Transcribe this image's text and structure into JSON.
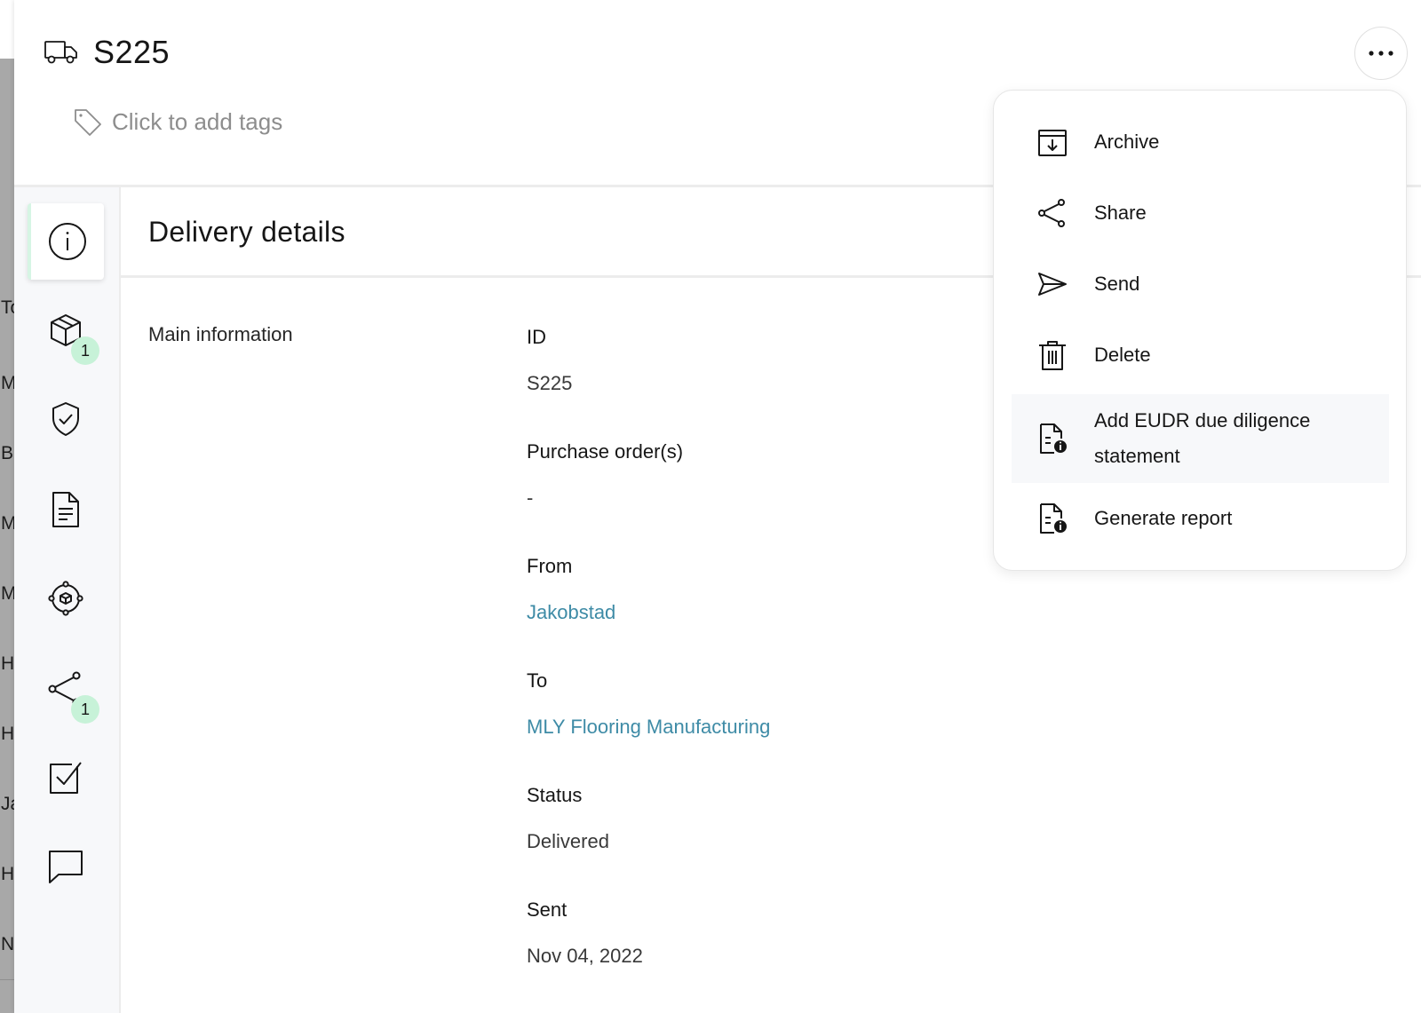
{
  "background_list": {
    "rows": [
      "To",
      "M",
      "B",
      "M",
      "M",
      "H",
      "H",
      "Ja",
      "H",
      "N"
    ]
  },
  "header": {
    "title": "S225",
    "tags_placeholder": "Click to add tags"
  },
  "rail": {
    "items": [
      {
        "icon": "info-icon",
        "active": true
      },
      {
        "icon": "package-icon",
        "badge": "1"
      },
      {
        "icon": "shield-check-icon"
      },
      {
        "icon": "document-icon"
      },
      {
        "icon": "network-icon"
      },
      {
        "icon": "share-icon",
        "badge": "1"
      },
      {
        "icon": "checkbox-icon"
      },
      {
        "icon": "comment-icon"
      }
    ]
  },
  "content": {
    "title": "Delivery details",
    "section": "Main information",
    "fields": [
      {
        "label": "ID",
        "value": "S225"
      },
      {
        "label": "Purchase order(s)",
        "value": "-"
      },
      {
        "label": "From",
        "value": "Jakobstad",
        "link": true
      },
      {
        "label": "To",
        "value": "MLY Flooring Manufacturing",
        "link": true
      },
      {
        "label": "Status",
        "value": "Delivered"
      },
      {
        "label": "Sent",
        "value": "Nov 04, 2022"
      }
    ]
  },
  "menu": {
    "items": [
      {
        "label": "Archive",
        "icon": "archive-icon"
      },
      {
        "label": "Share",
        "icon": "share-icon"
      },
      {
        "label": "Send",
        "icon": "send-icon"
      },
      {
        "label": "Delete",
        "icon": "trash-icon"
      },
      {
        "label_line1": "Add EUDR due diligence",
        "label_line2": "statement",
        "icon": "document-info-icon",
        "highlighted": true
      },
      {
        "label": "Generate report",
        "icon": "document-info-icon"
      }
    ]
  },
  "colors": {
    "link": "#3e8ba6",
    "badge": "#c7f2d8",
    "rail_bg": "#f7f8fa"
  }
}
